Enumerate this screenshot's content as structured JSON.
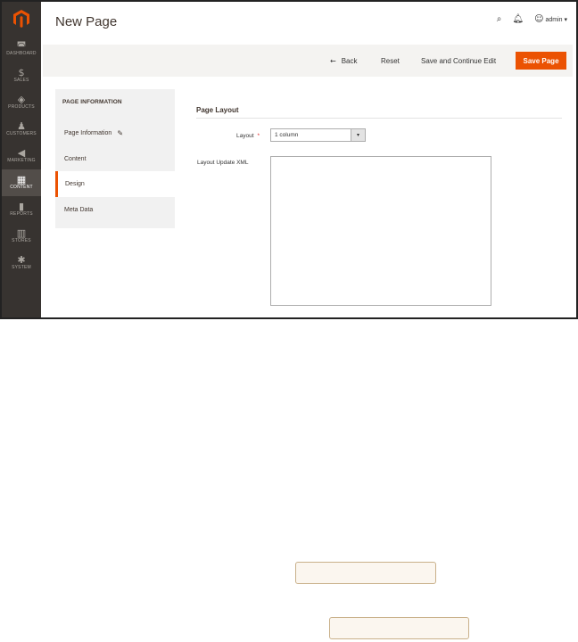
{
  "nav": {
    "items": [
      {
        "label": "DASHBOARD",
        "icon": "dashboard-icon",
        "glyph": "◚"
      },
      {
        "label": "SALES",
        "icon": "dollar-icon",
        "glyph": "$"
      },
      {
        "label": "PRODUCTS",
        "icon": "cube-icon",
        "glyph": "◈"
      },
      {
        "label": "CUSTOMERS",
        "icon": "person-icon",
        "glyph": "♟"
      },
      {
        "label": "MARKETING",
        "icon": "megaphone-icon",
        "glyph": "◀"
      },
      {
        "label": "CONTENT",
        "icon": "content-icon",
        "glyph": "▦",
        "active": true
      },
      {
        "label": "REPORTS",
        "icon": "bar-chart-icon",
        "glyph": "▮"
      },
      {
        "label": "STORES",
        "icon": "store-icon",
        "glyph": "▥"
      },
      {
        "label": "SYSTEM",
        "icon": "gear-icon",
        "glyph": "✱"
      }
    ]
  },
  "header": {
    "title": "New Page",
    "user": "admin"
  },
  "toolbar": {
    "back": "Back",
    "reset": "Reset",
    "save_continue": "Save and Continue Edit",
    "save_page": "Save Page"
  },
  "tabs": {
    "title": "PAGE INFORMATION",
    "items": [
      "Page Information",
      "Content",
      "Design",
      "Meta Data"
    ],
    "active": "Design"
  },
  "form": {
    "section_title": "Page Layout",
    "layout_label": "Layout",
    "layout_value": "1 column",
    "xml_label": "Layout Update XML"
  },
  "colors": {
    "accent": "#eb5202",
    "nav_bg": "#373330"
  }
}
